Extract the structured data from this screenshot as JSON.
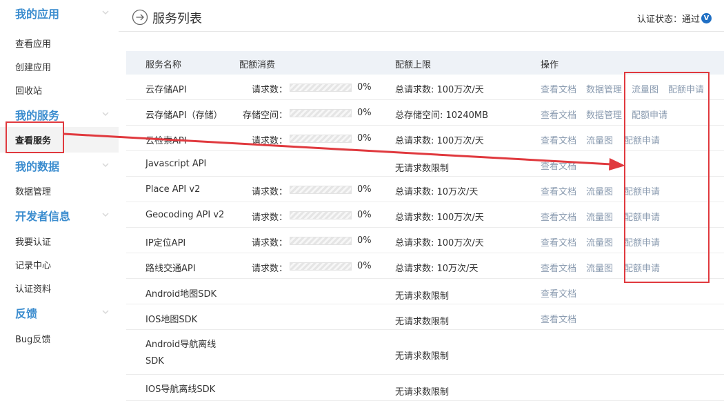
{
  "sidebar": {
    "sections": [
      {
        "title": "我的应用",
        "items": [
          "查看应用",
          "创建应用",
          "回收站"
        ]
      },
      {
        "title": "我的服务",
        "items": [
          "查看服务"
        ]
      },
      {
        "title": "我的数据",
        "items": [
          "数据管理"
        ]
      },
      {
        "title": "开发者信息",
        "items": [
          "我要认证",
          "记录中心",
          "认证资料"
        ]
      },
      {
        "title": "反馈",
        "items": [
          "Bug反馈"
        ]
      }
    ],
    "active_item": "查看服务"
  },
  "header": {
    "title": "服务列表",
    "auth_label": "认证状态：通过",
    "auth_badge": "V"
  },
  "table": {
    "columns": [
      "服务名称",
      "配额消费",
      "配额上限",
      "操作"
    ],
    "rows": [
      {
        "name": "云存储API",
        "usage_label": "请求数：",
        "usage_pct": "0%",
        "limit": "总请求数: 100万次/天",
        "ops": [
          "查看文档",
          "数据管理",
          "流量图",
          "配额申请"
        ]
      },
      {
        "name": "云存储API（存储）",
        "usage_label": "存储空间：",
        "usage_pct": "0%",
        "limit": "总存储空间: 10240MB",
        "ops": [
          "查看文档",
          "数据管理",
          "配额申请"
        ]
      },
      {
        "name": "云检索API",
        "usage_label": "请求数：",
        "usage_pct": "0%",
        "limit": "总请求数: 100万次/天",
        "ops": [
          "查看文档",
          "流量图",
          "配额申请"
        ]
      },
      {
        "name": "Javascript API",
        "limit": "无请求数限制",
        "ops": [
          "查看文档"
        ]
      },
      {
        "name": "Place API v2",
        "usage_label": "请求数：",
        "usage_pct": "0%",
        "limit": "总请求数: 10万次/天",
        "ops": [
          "查看文档",
          "流量图",
          "配额申请"
        ]
      },
      {
        "name": "Geocoding API v2",
        "usage_label": "请求数：",
        "usage_pct": "0%",
        "limit": "总请求数: 100万次/天",
        "ops": [
          "查看文档",
          "流量图",
          "配额申请"
        ]
      },
      {
        "name": "IP定位API",
        "usage_label": "请求数：",
        "usage_pct": "0%",
        "limit": "总请求数: 100万次/天",
        "ops": [
          "查看文档",
          "流量图",
          "配额申请"
        ]
      },
      {
        "name": "路线交通API",
        "usage_label": "请求数：",
        "usage_pct": "0%",
        "limit": "总请求数: 10万次/天",
        "ops": [
          "查看文档",
          "流量图",
          "配额申请"
        ]
      },
      {
        "name": "Android地图SDK",
        "limit": "无请求数限制",
        "ops": [
          "查看文档"
        ]
      },
      {
        "name": "IOS地图SDK",
        "limit": "无请求数限制",
        "ops": [
          "查看文档"
        ]
      },
      {
        "name_line1": "Android导航离线",
        "name_line2": "SDK",
        "limit": "无请求数限制",
        "ops": []
      },
      {
        "name": "IOS导航离线SDK",
        "limit": "无请求数限制",
        "ops": []
      }
    ]
  },
  "colors": {
    "accent": "#3c8dcf",
    "annotation": "#e0393e",
    "link_muted": "#8a9bb0",
    "header_bg": "#eef2f7"
  }
}
